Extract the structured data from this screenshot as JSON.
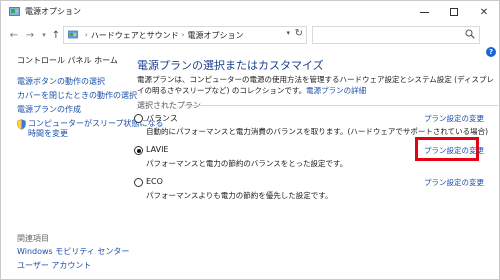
{
  "window": {
    "title": "電源オプション",
    "controls": {
      "minimize": "minimize",
      "maximize": "maximize",
      "close": "✕"
    }
  },
  "nav": {
    "breadcrumbs": [
      "ハードウェアとサウンド",
      "電源オプション"
    ],
    "search_placeholder": ""
  },
  "sidebar": {
    "home": "コントロール パネル ホーム",
    "links": [
      "電源ボタンの動作の選択",
      "カバーを閉じたときの動作の選択",
      "電源プランの作成",
      "コンピューターがスリープ状態になる時間を変更"
    ],
    "link4_line1": "コンピューターがスリープ状態になる",
    "link4_line2": "時間を変更",
    "related_heading": "関連項目",
    "related_links": [
      "Windows モビリティ センター",
      "ユーザー アカウント"
    ]
  },
  "main": {
    "heading": "電源プランの選択またはカスタマイズ",
    "desc_line1": "電源プランは、コンピューターの電源の使用方法を管理するハードウェア設定とシステム設定 (ディスプレイの明るさやスリープなど)",
    "desc_line2_prefix": "のコレクションです。",
    "desc_link": "電源プランの詳細",
    "group_label": "選択されたプラン",
    "plans": [
      {
        "name": "バランス",
        "description": "自動的にパフォーマンスと電力消費のバランスを取ります。(ハードウェアでサポートされている場合)",
        "change_label": "プラン設定の変更",
        "selected": false
      },
      {
        "name": "LAVIE",
        "description": "パフォーマンスと電力の節約のバランスをとった設定です。",
        "change_label": "プラン設定の変更",
        "selected": true,
        "highlighted": true
      },
      {
        "name": "ECO",
        "description": "パフォーマンスよりも電力の節約を優先した設定です。",
        "change_label": "プラン設定の変更",
        "selected": false
      }
    ]
  },
  "colors": {
    "link": "#1b4fa8",
    "heading": "#1e3f8f",
    "highlight": "#e60012"
  },
  "icons": {
    "app": "power-options-icon",
    "help": "help-icon"
  }
}
